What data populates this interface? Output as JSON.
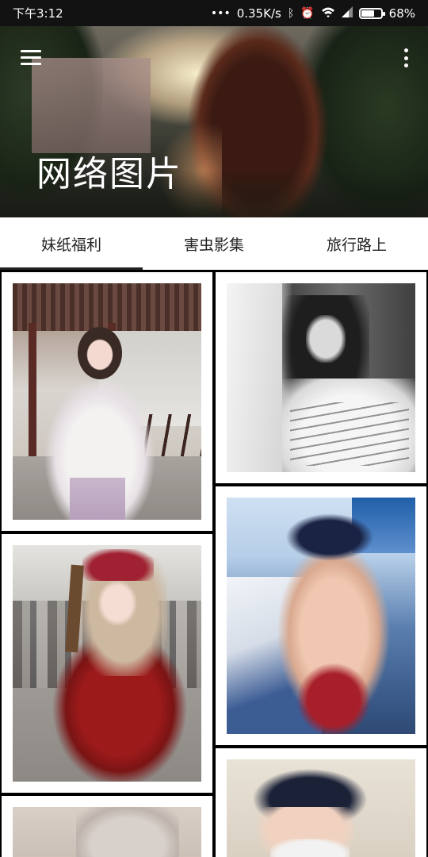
{
  "status_bar": {
    "time": "下午3:12",
    "network_speed": "0.35K/s",
    "battery_percent": "68%",
    "battery_level": 0.68,
    "icons": [
      "dots-icon",
      "bluetooth-icon",
      "alarm-icon",
      "wifi-icon",
      "signal-icon",
      "battery-icon"
    ]
  },
  "header": {
    "title": "网络图片",
    "menu_icon": "hamburger-menu-icon",
    "more_icon": "more-vertical-icon"
  },
  "tabs": [
    {
      "label": "妹纸福利",
      "selected": true
    },
    {
      "label": "害虫影集",
      "selected": false
    },
    {
      "label": "旅行路上",
      "selected": false
    }
  ],
  "colors": {
    "status_bar_bg": "#121212",
    "tab_bg": "#ffffff",
    "grid_bg": "#000000",
    "card_bg": "#ffffff"
  },
  "grid": {
    "photos": [
      {
        "description_icon": "photo-hanfu-girl"
      },
      {
        "description_icon": "photo-bw-girl"
      },
      {
        "description_icon": "photo-red-cosplay"
      },
      {
        "description_icon": "photo-navy-cap-girl"
      },
      {
        "description_icon": "photo-partial-bottom-left"
      },
      {
        "description_icon": "photo-partial-cap-mask"
      }
    ]
  }
}
